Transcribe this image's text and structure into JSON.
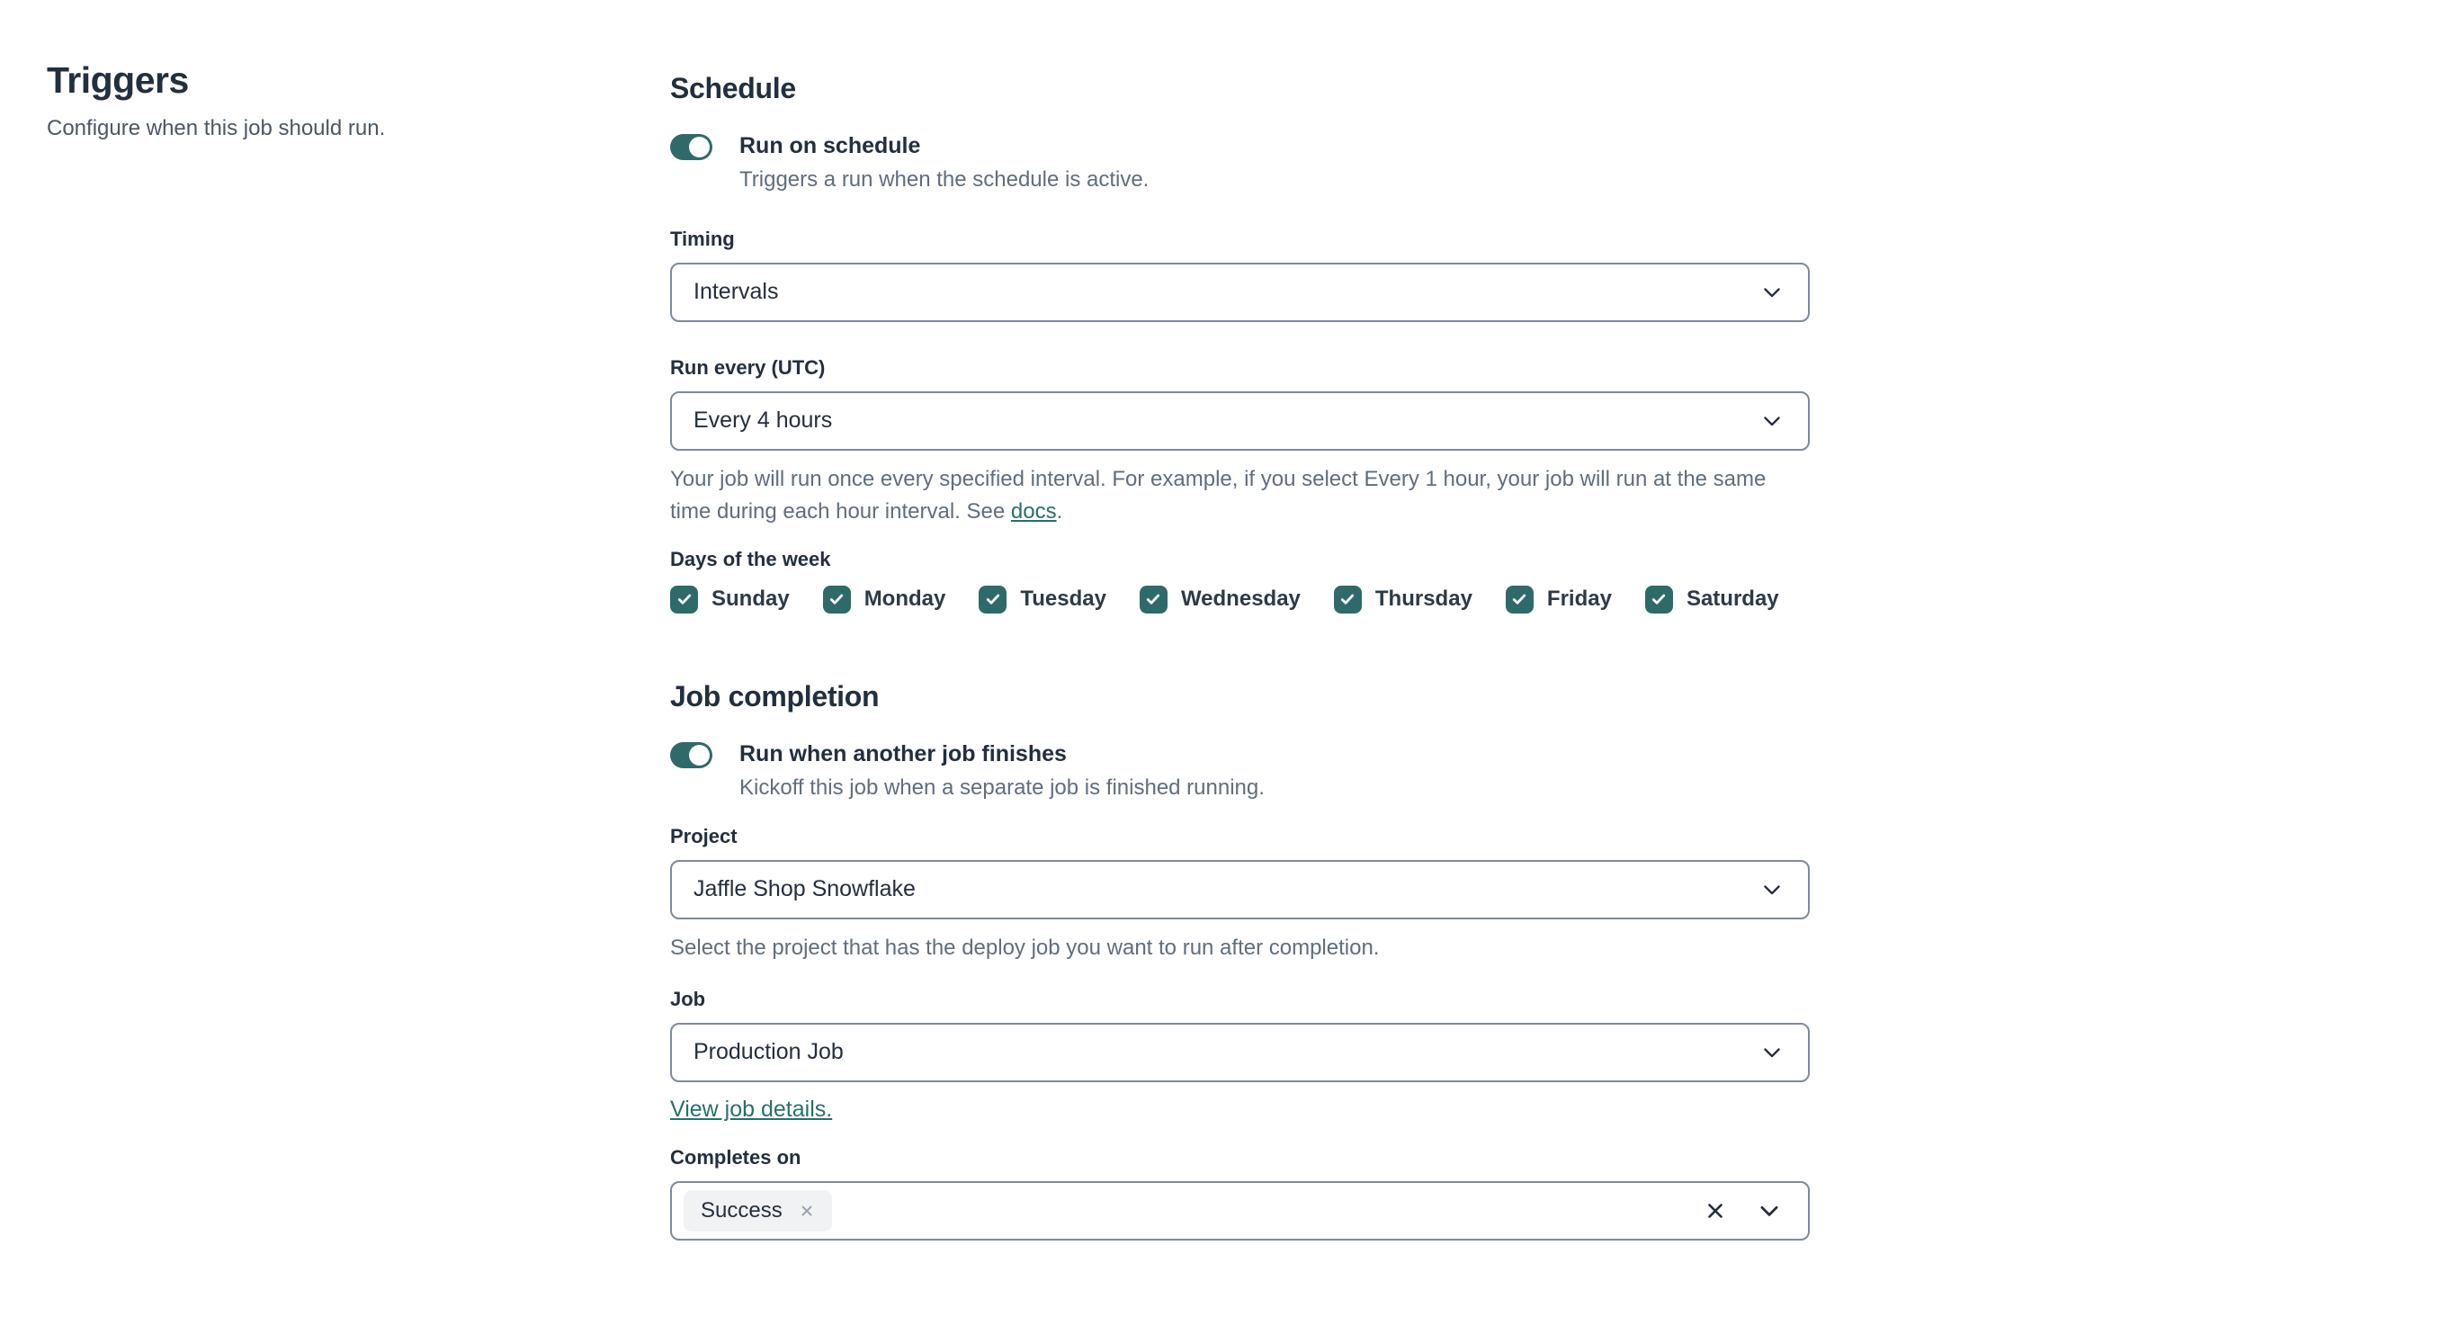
{
  "colors": {
    "accent_teal": "#2e6a69",
    "link_teal": "#26706b",
    "text_dark": "#232f3e",
    "text_gray": "#5f6e7e",
    "border_gray": "#7d8a9d",
    "chip_bg": "#f1f2f4"
  },
  "left": {
    "title": "Triggers",
    "subtitle": "Configure when this job should run."
  },
  "schedule": {
    "heading": "Schedule",
    "run_on_schedule": {
      "enabled": true,
      "label": "Run on schedule",
      "description": "Triggers a run when the schedule is active."
    },
    "timing": {
      "label": "Timing",
      "value": "Intervals"
    },
    "run_every": {
      "label": "Run every (UTC)",
      "value": "Every 4 hours",
      "help_text": "Your job will run once every specified interval. For example, if you select Every 1 hour, your job will run at the same time during each hour interval. See ",
      "help_link": "docs",
      "help_suffix": "."
    },
    "days_of_week": {
      "label": "Days of the week",
      "items": [
        {
          "label": "Sunday",
          "checked": true
        },
        {
          "label": "Monday",
          "checked": true
        },
        {
          "label": "Tuesday",
          "checked": true
        },
        {
          "label": "Wednesday",
          "checked": true
        },
        {
          "label": "Thursday",
          "checked": true
        },
        {
          "label": "Friday",
          "checked": true
        },
        {
          "label": "Saturday",
          "checked": true
        }
      ]
    }
  },
  "job_completion": {
    "heading": "Job completion",
    "run_when_finishes": {
      "enabled": true,
      "label": "Run when another job finishes",
      "description": "Kickoff this job when a separate job is finished running."
    },
    "project": {
      "label": "Project",
      "value": "Jaffle Shop Snowflake",
      "help": "Select the project that has the deploy job you want to run after completion."
    },
    "job": {
      "label": "Job",
      "value": "Production Job",
      "link": "View job details."
    },
    "completes_on": {
      "label": "Completes on",
      "selected": [
        {
          "label": "Success"
        }
      ]
    }
  }
}
